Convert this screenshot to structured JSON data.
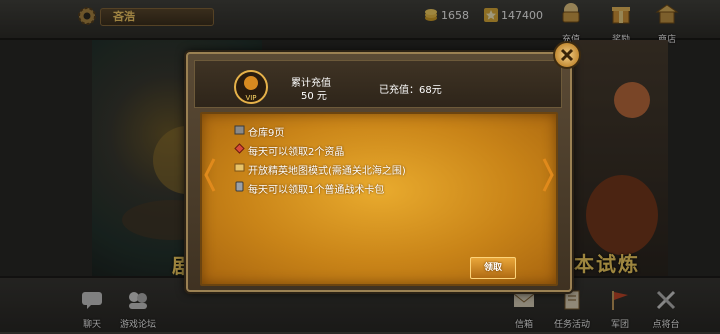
{
  "player": {
    "name": "吝浩"
  },
  "resources": {
    "gold": "1658",
    "stars": "147400"
  },
  "top_buttons": [
    {
      "label": "充值",
      "icon": "treasure-chest-icon"
    },
    {
      "label": "奖励",
      "icon": "gift-icon"
    },
    {
      "label": "商店",
      "icon": "shop-icon"
    }
  ],
  "bottom_buttons": [
    {
      "label": "聊天",
      "icon": "chat-icon"
    },
    {
      "label": "游戏论坛",
      "icon": "forum-icon"
    },
    {
      "label": "信箱",
      "icon": "mail-icon"
    },
    {
      "label": "任务活动",
      "icon": "quest-icon"
    },
    {
      "label": "军团",
      "icon": "legion-icon"
    },
    {
      "label": "点将台",
      "icon": "general-icon"
    }
  ],
  "background_text": {
    "left": "剧",
    "right": "本试炼"
  },
  "dialog": {
    "accumulated_label": "累计充值",
    "accumulated_value": "50 元",
    "recharged": "已充值：68元",
    "perks": [
      {
        "text": "仓库9页",
        "icon": "warehouse-icon"
      },
      {
        "text": "每天可以领取2个资晶",
        "icon": "crystal-icon"
      },
      {
        "text": "开放精英地图模式(需通关北海之围)",
        "icon": "map-icon"
      },
      {
        "text": "每天可以领取1个普通战术卡包",
        "icon": "card-pack-icon"
      }
    ],
    "claim_label": "领取"
  },
  "colors": {
    "accent": "#ffd36b",
    "panel": "#d88f1d",
    "frame": "#9b8153"
  }
}
